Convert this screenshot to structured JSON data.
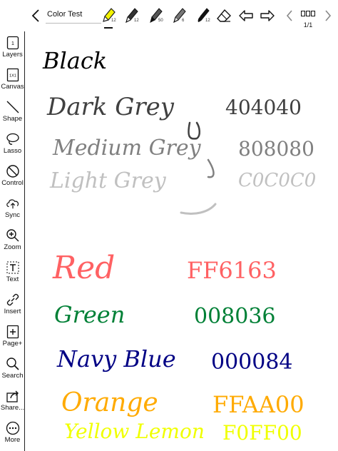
{
  "toolbar": {
    "title": "Color Test",
    "pens": [
      {
        "name": "highlighter",
        "size": "12",
        "color": "#e6e600"
      },
      {
        "name": "fountain-pen",
        "size": "12",
        "color": "#222222"
      },
      {
        "name": "marker",
        "size": "50",
        "color": "#222222"
      },
      {
        "name": "pencil",
        "size": "6",
        "color": "#222222"
      },
      {
        "name": "brush",
        "size": "12",
        "color": "#222222"
      }
    ],
    "page_indicator": "1/1"
  },
  "sidebar": {
    "items": [
      {
        "label": "Layers",
        "icon": "layers-icon",
        "badge": "1"
      },
      {
        "label": "Canvas",
        "icon": "canvas-icon",
        "badge": "1X1"
      },
      {
        "label": "Shape",
        "icon": "shape-icon"
      },
      {
        "label": "Lasso",
        "icon": "lasso-icon"
      },
      {
        "label": "Control",
        "icon": "control-icon"
      },
      {
        "label": "Sync",
        "icon": "sync-icon"
      },
      {
        "label": "Zoom",
        "icon": "zoom-icon"
      },
      {
        "label": "Text",
        "icon": "text-icon"
      },
      {
        "label": "Insert",
        "icon": "insert-icon"
      },
      {
        "label": "Page+",
        "icon": "page-add-icon"
      },
      {
        "label": "Search",
        "icon": "search-icon"
      },
      {
        "label": "Share...",
        "icon": "share-icon"
      },
      {
        "label": "More",
        "icon": "more-icon"
      }
    ]
  },
  "ink": [
    {
      "name": "black",
      "text": "Black",
      "color": "#000000"
    },
    {
      "name": "dark-grey",
      "text": "Dark Grey",
      "hex": "404040",
      "color": "#404040"
    },
    {
      "name": "medium-grey",
      "text": "Medium Grey",
      "hex": "808080",
      "color": "#808080"
    },
    {
      "name": "light-grey",
      "text": "Light Grey",
      "hex": "C0C0C0",
      "color": "#C0C0C0"
    },
    {
      "name": "red",
      "text": "Red",
      "hex": "FF6163",
      "color": "#FF6163"
    },
    {
      "name": "green",
      "text": "Green",
      "hex": "008036",
      "color": "#008036"
    },
    {
      "name": "navy-blue",
      "text": "Navy Blue",
      "hex": "000084",
      "color": "#000084"
    },
    {
      "name": "orange",
      "text": "Orange",
      "hex": "FFAA00",
      "color": "#FFAA00"
    },
    {
      "name": "yellow-lemon",
      "text": "Yellow Lemon",
      "hex": "F0FF00",
      "color": "#F0FF00"
    }
  ]
}
